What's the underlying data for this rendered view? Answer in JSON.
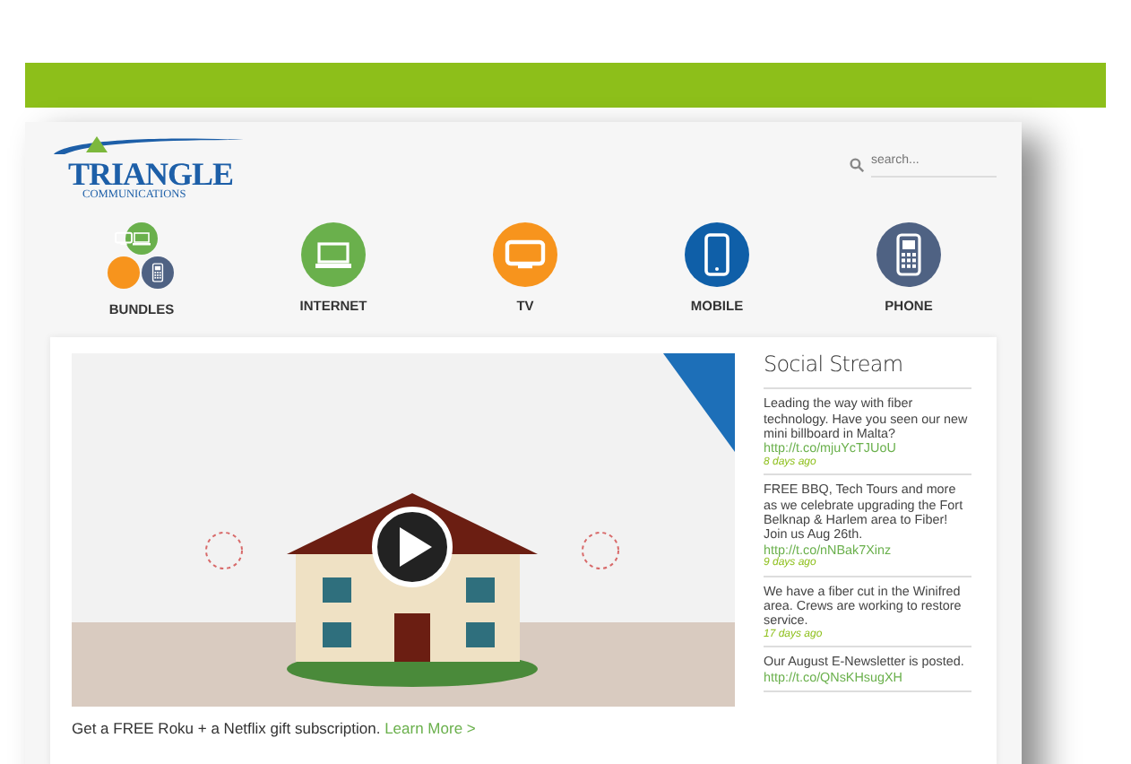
{
  "logo": {
    "name": "TRIANGLE",
    "tagline": "COMMUNICATIONS"
  },
  "search": {
    "placeholder": "search..."
  },
  "nav": [
    {
      "label": "BUNDLES",
      "kind": "bundles",
      "color": "#6ab04c"
    },
    {
      "label": "INTERNET",
      "kind": "laptop",
      "color": "#6ab04c"
    },
    {
      "label": "TV",
      "kind": "tv",
      "color": "#f7941d"
    },
    {
      "label": "MOBILE",
      "kind": "mobile",
      "color": "#0f5fa8"
    },
    {
      "label": "PHONE",
      "kind": "phone",
      "color": "#4f6283"
    }
  ],
  "promo": {
    "text": "Get a FREE Roku + a Netflix gift subscription.",
    "link": "Learn More >"
  },
  "social": {
    "title": "Social Stream",
    "posts": [
      {
        "text": "Leading the way with fiber technology. Have you seen our new mini billboard in Malta?",
        "link": "http://t.co/mjuYcTJUoU",
        "time": "8 days ago"
      },
      {
        "text": "FREE BBQ, Tech Tours and more as we celebrate upgrading the Fort Belknap & Harlem area to Fiber! Join us Aug 26th.",
        "link": "http://t.co/nNBak7Xinz",
        "time": "9 days ago"
      },
      {
        "text": "We have a fiber cut in the Winifred area. Crews are working to restore service.",
        "time": "17 days ago"
      },
      {
        "text": "Our August E-Newsletter is posted.",
        "link": "http://t.co/QNsKHsugXH"
      }
    ]
  }
}
